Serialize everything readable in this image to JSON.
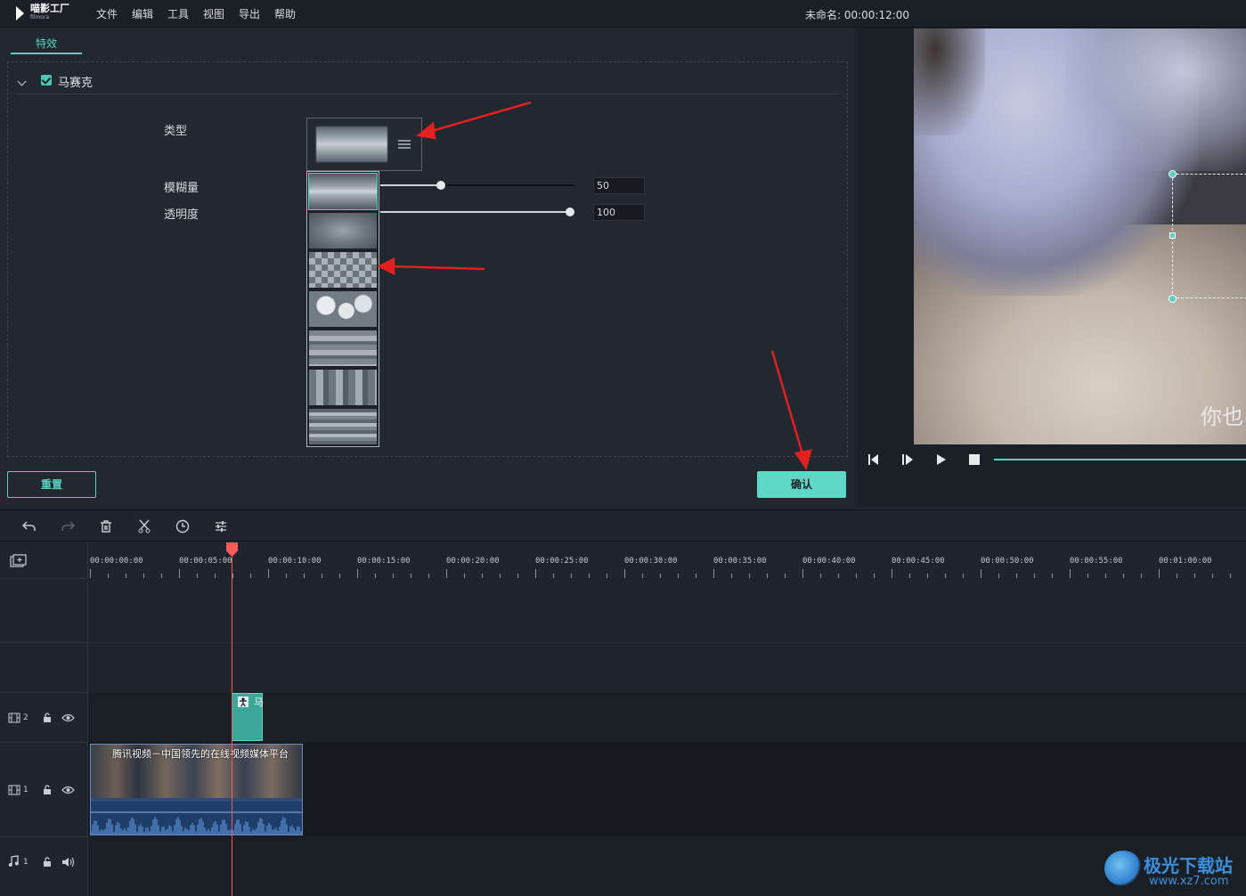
{
  "menubar": {
    "logo_main": "喵影工厂",
    "logo_sub": "filmora",
    "items": [
      "文件",
      "编辑",
      "工具",
      "视图",
      "导出",
      "帮助"
    ],
    "project_title": "未命名: 00:00:12:00"
  },
  "effects": {
    "tab": "特效",
    "section_title": "马赛克",
    "section_checked": true,
    "type_label": "类型",
    "blur_label": "模糊量",
    "opacity_label": "透明度",
    "blur_value": "50",
    "opacity_value": "100",
    "blur_level_fraction": 0.3,
    "opacity_level_fraction": 1.0,
    "type_options": [
      "blur-1",
      "blur-2",
      "mosaic-grid",
      "bokeh",
      "horizontal-bars",
      "vertical-bars",
      "scanlines"
    ],
    "selected_option": "blur-1",
    "reset_label": "重置",
    "confirm_label": "确认"
  },
  "preview": {
    "subtitle": "你也"
  },
  "timeline": {
    "ticks": [
      "00:00:00:00",
      "00:00:05:00",
      "00:00:10:00",
      "00:00:15:00",
      "00:00:20:00",
      "00:00:25:00",
      "00:00:30:00",
      "00:00:35:00",
      "00:00:40:00",
      "00:00:45:00",
      "00:00:50:00",
      "00:00:55:00",
      "00:01:00:00"
    ],
    "tracks": {
      "v2": "2",
      "v1": "1",
      "a1": "1"
    },
    "effect_clip_label": "马",
    "video_clip_title": "腾讯视频－中国领先的在线视频媒体平台"
  },
  "watermark": {
    "name": "极光下载站",
    "url": "www.xz7.com"
  },
  "colors": {
    "accent": "#56d0bf",
    "playhead": "#ff5a5a",
    "clip_blue": "#2d4b78"
  }
}
